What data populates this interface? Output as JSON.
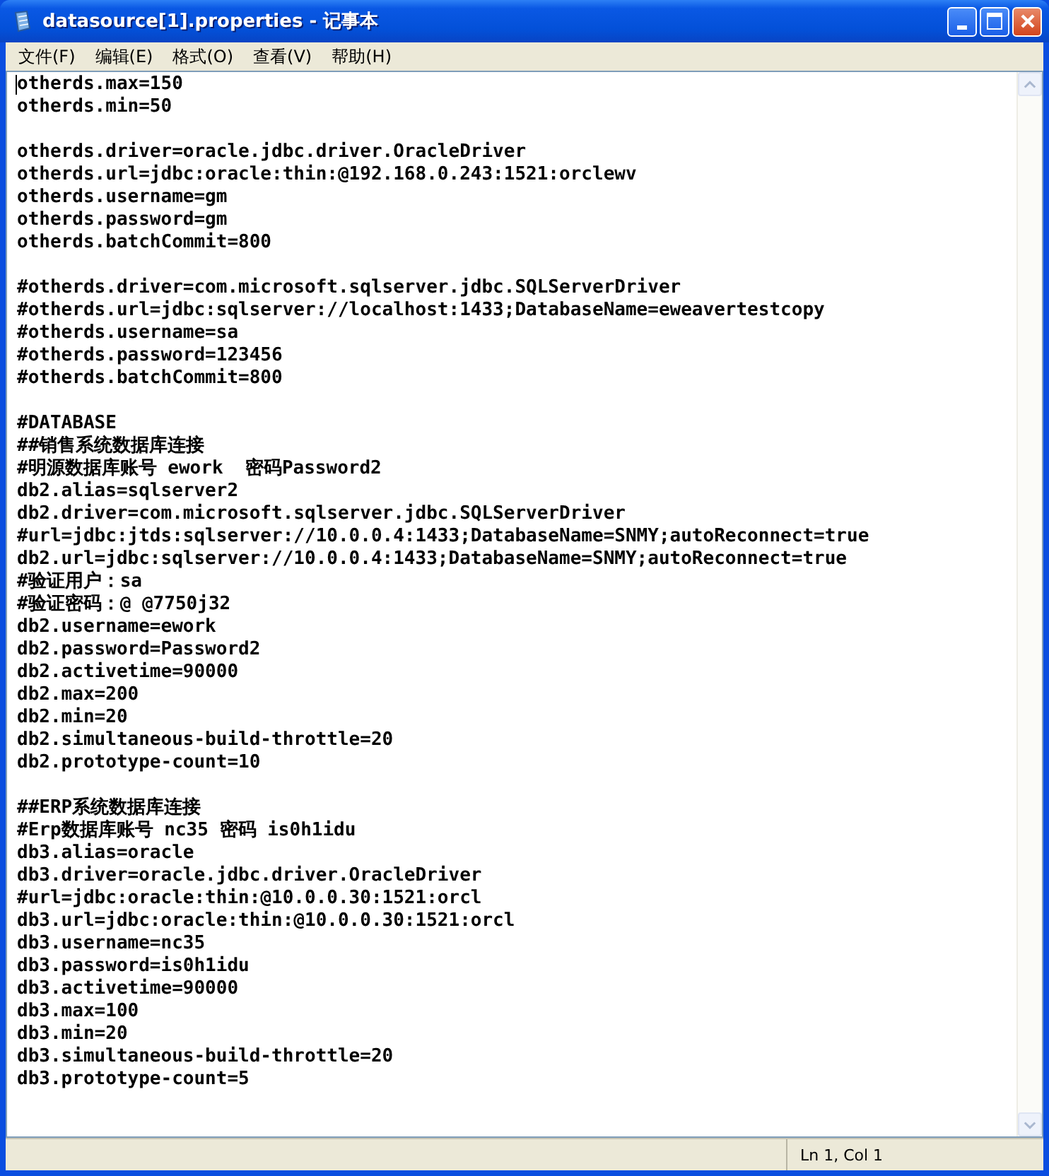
{
  "window": {
    "title": "datasource[1].properties - 记事本"
  },
  "menu": [
    "文件(F)",
    "编辑(E)",
    "格式(O)",
    "查看(V)",
    "帮助(H)"
  ],
  "paragraphs": [
    [
      "otherds.max=150",
      "otherds.min=50"
    ],
    [
      "otherds.driver=oracle.jdbc.driver.OracleDriver",
      "otherds.url=jdbc:oracle:thin:@192.168.0.243:1521:orclewv",
      "otherds.username=gm",
      "otherds.password=gm",
      "otherds.batchCommit=800"
    ],
    [
      "#otherds.driver=com.microsoft.sqlserver.jdbc.SQLServerDriver",
      "#otherds.url=jdbc:sqlserver://localhost:1433;DatabaseName=eweavertestcopy",
      "#otherds.username=sa",
      "#otherds.password=123456",
      "#otherds.batchCommit=800"
    ],
    [
      "#DATABASE",
      "##销售系统数据库连接",
      "#明源数据库账号 ework  密码Password2",
      "db2.alias=sqlserver2",
      "db2.driver=com.microsoft.sqlserver.jdbc.SQLServerDriver",
      "#url=jdbc:jtds:sqlserver://10.0.0.4:1433;DatabaseName=SNMY;autoReconnect=true",
      "db2.url=jdbc:sqlserver://10.0.0.4:1433;DatabaseName=SNMY;autoReconnect=true",
      "#验证用户：sa",
      "#验证密码：@ @7750j32",
      "db2.username=ework",
      "db2.password=Password2",
      "db2.activetime=90000",
      "db2.max=200",
      "db2.min=20",
      "db2.simultaneous-build-throttle=20",
      "db2.prototype-count=10"
    ],
    [
      "##ERP系统数据库连接",
      "#Erp数据库账号 nc35 密码 is0h1idu",
      "db3.alias=oracle",
      "db3.driver=oracle.jdbc.driver.OracleDriver",
      "#url=jdbc:oracle:thin:@10.0.0.30:1521:orcl",
      "db3.url=jdbc:oracle:thin:@10.0.0.30:1521:orcl",
      "db3.username=nc35",
      "db3.password=is0h1idu",
      "db3.activetime=90000",
      "db3.max=100",
      "db3.min=20",
      "db3.simultaneous-build-throttle=20",
      "db3.prototype-count=5"
    ]
  ],
  "status_bar": {
    "position": "Ln 1, Col 1"
  }
}
